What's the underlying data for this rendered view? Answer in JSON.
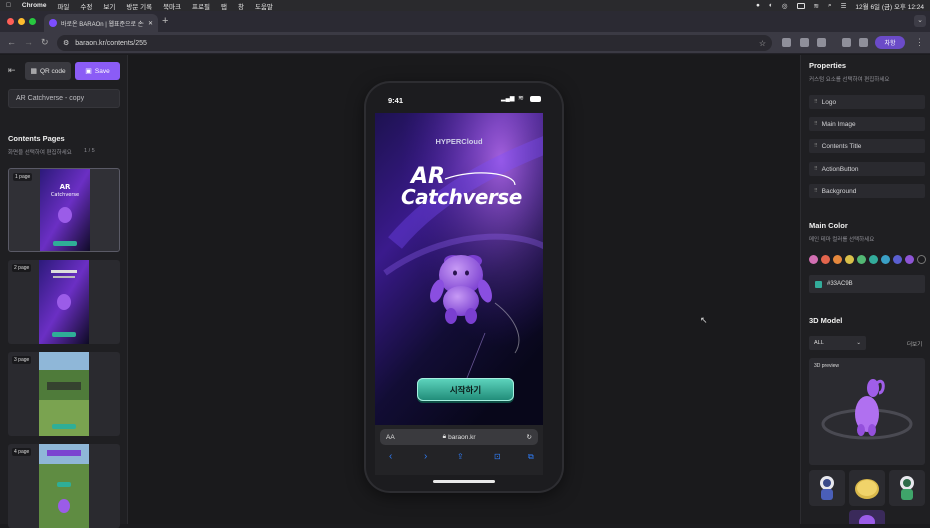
{
  "menubar": {
    "app": "Chrome",
    "items": [
      "파일",
      "수정",
      "보기",
      "방문 기록",
      "북마크",
      "프로필",
      "탭",
      "창",
      "도움말"
    ],
    "datetime": "12월 6일 (금) 오후 12:24"
  },
  "browser": {
    "tab_title": "바로온 BARAOn | 웹표준으로 손쉬운...",
    "url": "baraon.kr/contents/255",
    "profile_label": "차항"
  },
  "editor": {
    "qr_label": "QR code",
    "save_label": "Save",
    "title_value": "AR Catchverse - copy",
    "pages_title": "Contents Pages",
    "pages_sub": "화면을 선택하여 편집하세요",
    "pages_count": "1 / 5",
    "pages": [
      {
        "label": "1 page"
      },
      {
        "label": "2 page"
      },
      {
        "label": "3 page"
      },
      {
        "label": "4 page"
      }
    ]
  },
  "phone": {
    "time": "9:41",
    "brand": "HYPERCloud",
    "title_line1": "AR",
    "title_line2": "Catchverse",
    "start_button": "시작하기",
    "safari_aa": "AA",
    "safari_url": "baraon.kr"
  },
  "properties": {
    "title": "Properties",
    "sub": "커스텀 요소를 선택하여 편집하세요",
    "items": [
      "Logo",
      "Main Image",
      "Contents Title",
      "ActionButton",
      "Background"
    ],
    "main_color_title": "Main Color",
    "main_color_sub": "메인 테마 컬러를 선택하세요",
    "swatches": [
      "#d26fb3",
      "#e3654d",
      "#e6883d",
      "#d9c04a",
      "#53b874",
      "#33ac9b",
      "#3aa0c6",
      "#5a5fd0",
      "#8e55d6",
      "#1b1b1e"
    ],
    "color_value": "#33AC9B",
    "model_title": "3D Model",
    "filter_value": "ALL",
    "more_label": "더보기",
    "preview_label": "3D preview"
  }
}
